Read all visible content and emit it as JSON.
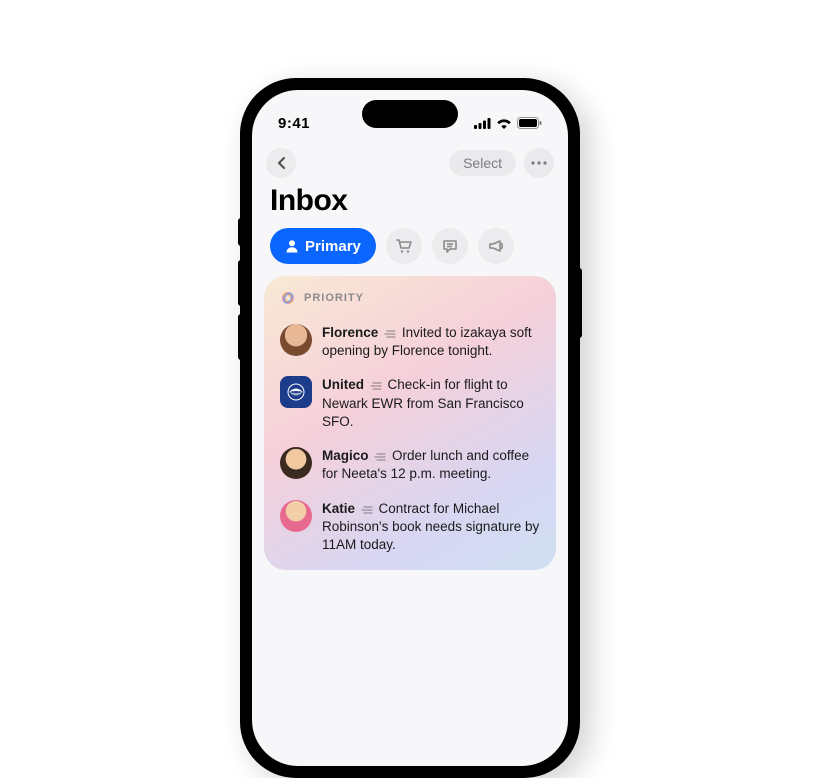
{
  "status": {
    "time": "9:41"
  },
  "nav": {
    "select_label": "Select"
  },
  "title": "Inbox",
  "tabs": {
    "primary_label": "Primary"
  },
  "priority": {
    "label": "PRIORITY",
    "items": [
      {
        "sender": "Florence",
        "preview": "Invited to izakaya soft opening by Florence tonight."
      },
      {
        "sender": "United",
        "preview": "Check-in for flight to Newark EWR from San Francisco SFO."
      },
      {
        "sender": "Magico",
        "preview": "Order lunch and coffee for Neeta's 12 p.m. meeting."
      },
      {
        "sender": "Katie",
        "preview": "Contract for Michael Robinson's book needs signature by 11AM today."
      }
    ]
  }
}
